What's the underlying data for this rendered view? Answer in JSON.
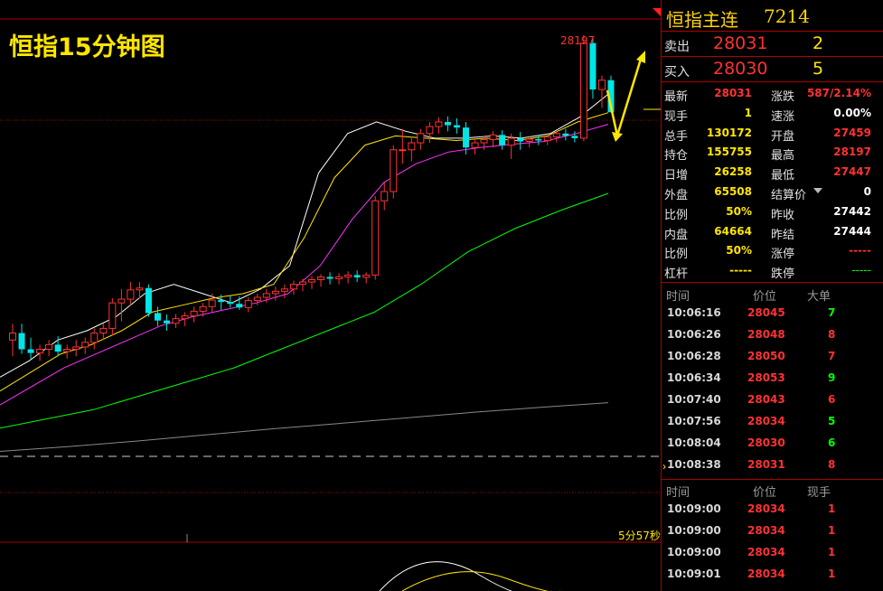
{
  "chart": {
    "title": "恒指15分钟图",
    "peak_label": "28197",
    "timer": "5分57秒"
  },
  "chart_data": {
    "type": "candlestick",
    "candles": [
      {
        "o": 27540,
        "h": 27575,
        "l": 27505,
        "c": 27555
      },
      {
        "o": 27555,
        "h": 27575,
        "l": 27510,
        "c": 27520
      },
      {
        "o": 27520,
        "h": 27545,
        "l": 27500,
        "c": 27512
      },
      {
        "o": 27512,
        "h": 27530,
        "l": 27495,
        "c": 27520
      },
      {
        "o": 27520,
        "h": 27540,
        "l": 27505,
        "c": 27530
      },
      {
        "o": 27530,
        "h": 27548,
        "l": 27505,
        "c": 27515
      },
      {
        "o": 27515,
        "h": 27530,
        "l": 27500,
        "c": 27520
      },
      {
        "o": 27520,
        "h": 27540,
        "l": 27505,
        "c": 27525
      },
      {
        "o": 27525,
        "h": 27545,
        "l": 27510,
        "c": 27535
      },
      {
        "o": 27535,
        "h": 27565,
        "l": 27520,
        "c": 27555
      },
      {
        "o": 27555,
        "h": 27575,
        "l": 27540,
        "c": 27565
      },
      {
        "o": 27565,
        "h": 27630,
        "l": 27550,
        "c": 27620
      },
      {
        "o": 27620,
        "h": 27650,
        "l": 27580,
        "c": 27628
      },
      {
        "o": 27628,
        "h": 27665,
        "l": 27615,
        "c": 27648
      },
      {
        "o": 27648,
        "h": 27665,
        "l": 27630,
        "c": 27652
      },
      {
        "o": 27652,
        "h": 27660,
        "l": 27590,
        "c": 27598
      },
      {
        "o": 27598,
        "h": 27612,
        "l": 27570,
        "c": 27582
      },
      {
        "o": 27582,
        "h": 27595,
        "l": 27560,
        "c": 27576
      },
      {
        "o": 27576,
        "h": 27596,
        "l": 27566,
        "c": 27586
      },
      {
        "o": 27586,
        "h": 27600,
        "l": 27570,
        "c": 27592
      },
      {
        "o": 27592,
        "h": 27612,
        "l": 27578,
        "c": 27602
      },
      {
        "o": 27602,
        "h": 27620,
        "l": 27590,
        "c": 27612
      },
      {
        "o": 27612,
        "h": 27640,
        "l": 27600,
        "c": 27626
      },
      {
        "o": 27626,
        "h": 27638,
        "l": 27605,
        "c": 27622
      },
      {
        "o": 27622,
        "h": 27635,
        "l": 27610,
        "c": 27618
      },
      {
        "o": 27618,
        "h": 27634,
        "l": 27605,
        "c": 27610
      },
      {
        "o": 27610,
        "h": 27632,
        "l": 27600,
        "c": 27625
      },
      {
        "o": 27625,
        "h": 27640,
        "l": 27615,
        "c": 27632
      },
      {
        "o": 27632,
        "h": 27650,
        "l": 27620,
        "c": 27640
      },
      {
        "o": 27640,
        "h": 27655,
        "l": 27625,
        "c": 27645
      },
      {
        "o": 27645,
        "h": 27660,
        "l": 27630,
        "c": 27650
      },
      {
        "o": 27650,
        "h": 27668,
        "l": 27638,
        "c": 27660
      },
      {
        "o": 27660,
        "h": 27672,
        "l": 27645,
        "c": 27665
      },
      {
        "o": 27665,
        "h": 27678,
        "l": 27650,
        "c": 27670
      },
      {
        "o": 27670,
        "h": 27682,
        "l": 27655,
        "c": 27676
      },
      {
        "o": 27676,
        "h": 27686,
        "l": 27660,
        "c": 27672
      },
      {
        "o": 27672,
        "h": 27684,
        "l": 27660,
        "c": 27676
      },
      {
        "o": 27676,
        "h": 27688,
        "l": 27662,
        "c": 27680
      },
      {
        "o": 27680,
        "h": 27690,
        "l": 27665,
        "c": 27675
      },
      {
        "o": 27675,
        "h": 27686,
        "l": 27662,
        "c": 27680
      },
      {
        "o": 27680,
        "h": 27850,
        "l": 27670,
        "c": 27840
      },
      {
        "o": 27840,
        "h": 27880,
        "l": 27820,
        "c": 27860
      },
      {
        "o": 27860,
        "h": 27960,
        "l": 27845,
        "c": 27950
      },
      {
        "o": 27950,
        "h": 27995,
        "l": 27920,
        "c": 27950
      },
      {
        "o": 27950,
        "h": 27978,
        "l": 27925,
        "c": 27965
      },
      {
        "o": 27965,
        "h": 27995,
        "l": 27950,
        "c": 27985
      },
      {
        "o": 27985,
        "h": 28010,
        "l": 27965,
        "c": 28000
      },
      {
        "o": 28000,
        "h": 28020,
        "l": 27985,
        "c": 28010
      },
      {
        "o": 28010,
        "h": 28022,
        "l": 27990,
        "c": 28003
      },
      {
        "o": 28003,
        "h": 28018,
        "l": 27985,
        "c": 27998
      },
      {
        "o": 27998,
        "h": 28010,
        "l": 27940,
        "c": 27955
      },
      {
        "o": 27955,
        "h": 27975,
        "l": 27940,
        "c": 27965
      },
      {
        "o": 27965,
        "h": 27980,
        "l": 27950,
        "c": 27972
      },
      {
        "o": 27972,
        "h": 27990,
        "l": 27955,
        "c": 27982
      },
      {
        "o": 27982,
        "h": 27992,
        "l": 27950,
        "c": 27960
      },
      {
        "o": 27960,
        "h": 27985,
        "l": 27930,
        "c": 27975
      },
      {
        "o": 27975,
        "h": 27988,
        "l": 27950,
        "c": 27968
      },
      {
        "o": 27968,
        "h": 27980,
        "l": 27955,
        "c": 27973
      },
      {
        "o": 27973,
        "h": 27982,
        "l": 27960,
        "c": 27970
      },
      {
        "o": 27970,
        "h": 27984,
        "l": 27960,
        "c": 27978
      },
      {
        "o": 27978,
        "h": 27990,
        "l": 27966,
        "c": 27985
      },
      {
        "o": 27985,
        "h": 27995,
        "l": 27970,
        "c": 27980
      },
      {
        "o": 27980,
        "h": 27990,
        "l": 27966,
        "c": 27975
      },
      {
        "o": 27975,
        "h": 28197,
        "l": 27968,
        "c": 28180
      },
      {
        "o": 28180,
        "h": 28190,
        "l": 28060,
        "c": 28080
      },
      {
        "o": 28080,
        "h": 28110,
        "l": 28040,
        "c": 28100
      },
      {
        "o": 28100,
        "h": 28110,
        "l": 28030,
        "c": 28031
      }
    ],
    "ma_curves": [
      {
        "color": "#ffffff",
        "y": [
          27460,
          27495,
          27540,
          27560,
          27590,
          27640,
          27660,
          27640,
          27620,
          27650,
          27700,
          27900,
          27985,
          28010,
          27990,
          27975,
          27975,
          27980,
          27975,
          27985,
          28020,
          28070
        ]
      },
      {
        "color": "#ffe600",
        "y": [
          27430,
          27470,
          27510,
          27530,
          27560,
          27600,
          27615,
          27630,
          27640,
          27660,
          27760,
          27890,
          27960,
          27980,
          27975,
          27970,
          27975,
          27970,
          27980,
          28010,
          28030
        ]
      },
      {
        "color": "#ff33ff",
        "y": [
          27400,
          27440,
          27480,
          27510,
          27540,
          27570,
          27590,
          27605,
          27620,
          27640,
          27700,
          27800,
          27880,
          27920,
          27945,
          27955,
          27962,
          27968,
          27985,
          28005
        ]
      },
      {
        "color": "#00ff00",
        "y": [
          27350,
          27370,
          27390,
          27420,
          27450,
          27480,
          27520,
          27560,
          27600,
          27660,
          27730,
          27780,
          27820,
          27856
        ]
      },
      {
        "color": "#888888",
        "y": [
          27300,
          27310,
          27322,
          27335,
          27348,
          27360,
          27372,
          27384,
          27395,
          27405
        ]
      }
    ],
    "ylim": [
      27260,
      28230
    ]
  },
  "panel": {
    "name": "恒指主连",
    "code": "7214",
    "sell": {
      "label": "卖出",
      "price": "28031",
      "vol": "2"
    },
    "buy": {
      "label": "买入",
      "price": "28030",
      "vol": "5"
    },
    "quotes": [
      {
        "l1": "最新",
        "v1": "28031",
        "c1": "r",
        "l2": "涨跌",
        "v2": "587/2.14%",
        "c2": "r"
      },
      {
        "l1": "现手",
        "v1": "1",
        "c1": "y",
        "l2": "速涨",
        "v2": "0.00%",
        "c2": "w"
      },
      {
        "l1": "总手",
        "v1": "130172",
        "c1": "y",
        "l2": "开盘",
        "v2": "27459",
        "c2": "r"
      },
      {
        "l1": "持仓",
        "v1": "155755",
        "c1": "y",
        "l2": "最高",
        "v2": "28197",
        "c2": "r"
      },
      {
        "l1": "日增",
        "v1": "26258",
        "c1": "y",
        "l2": "最低",
        "v2": "27447",
        "c2": "r"
      },
      {
        "l1": "外盘",
        "v1": "65508",
        "c1": "y",
        "l2": "结算价",
        "v2": "0",
        "c2": "w"
      },
      {
        "l1": "比例",
        "v1": "50%",
        "c1": "y",
        "l2": "昨收",
        "v2": "27442",
        "c2": "w"
      },
      {
        "l1": "内盘",
        "v1": "64664",
        "c1": "y",
        "l2": "昨结",
        "v2": "27444",
        "c2": "w"
      },
      {
        "l1": "比例",
        "v1": "50%",
        "c1": "y",
        "l2": "涨停",
        "v2": "-----",
        "c2": "r"
      },
      {
        "l1": "杠杆",
        "v1": "-----",
        "c1": "y",
        "l2": "跌停",
        "v2": "-----",
        "c2": "g"
      }
    ],
    "ticks1_head": {
      "time": "时间",
      "price": "价位",
      "vol": "大单"
    },
    "ticks1": [
      {
        "time": "10:06:16",
        "price": "28045",
        "vol": "7",
        "c": "g"
      },
      {
        "time": "10:06:26",
        "price": "28048",
        "vol": "8",
        "c": "r"
      },
      {
        "time": "10:06:28",
        "price": "28050",
        "vol": "7",
        "c": "r"
      },
      {
        "time": "10:06:34",
        "price": "28053",
        "vol": "9",
        "c": "g"
      },
      {
        "time": "10:07:40",
        "price": "28043",
        "vol": "6",
        "c": "r"
      },
      {
        "time": "10:07:56",
        "price": "28034",
        "vol": "5",
        "c": "g"
      },
      {
        "time": "10:08:04",
        "price": "28030",
        "vol": "6",
        "c": "g"
      },
      {
        "time": "10:08:38",
        "price": "28031",
        "vol": "8",
        "c": "r"
      }
    ],
    "ticks2_head": {
      "time": "时间",
      "price": "价位",
      "vol": "现手"
    },
    "ticks2": [
      {
        "time": "10:09:00",
        "price": "28034",
        "vol": "1",
        "c": "r"
      },
      {
        "time": "10:09:00",
        "price": "28034",
        "vol": "1",
        "c": "r"
      },
      {
        "time": "10:09:00",
        "price": "28034",
        "vol": "1",
        "c": "r"
      },
      {
        "time": "10:09:01",
        "price": "28034",
        "vol": "1",
        "c": "r"
      }
    ],
    "colors": {
      "up": "#ff3232",
      "down": "#00e5e5",
      "accent": "#ffe600",
      "border": "#b00000"
    }
  }
}
